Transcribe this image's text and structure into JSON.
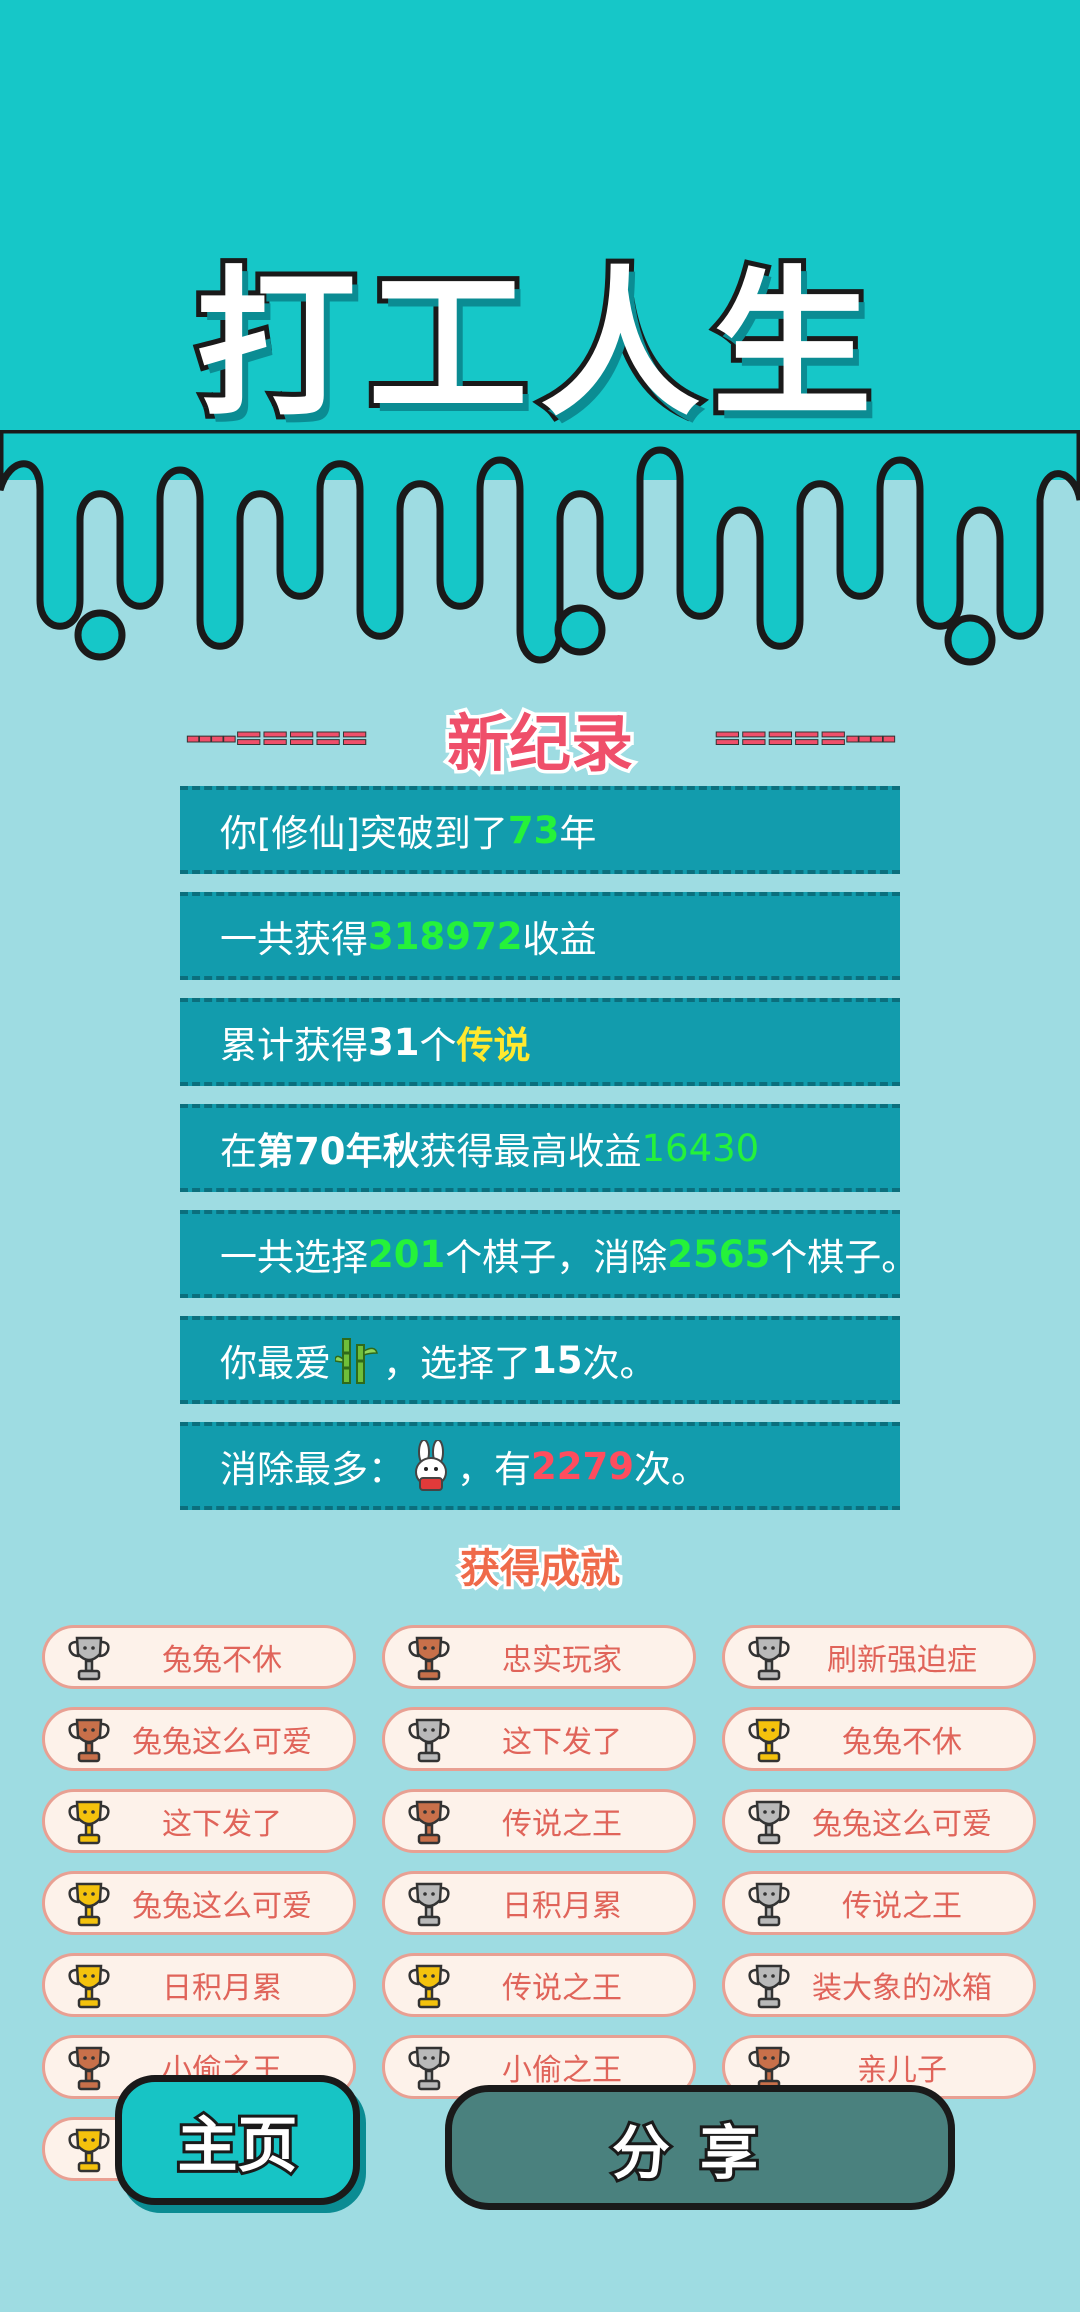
{
  "header": {
    "title": "打工人生"
  },
  "record": {
    "dash_left": "----=====",
    "heading": "新纪录",
    "dash_right": "=====----",
    "rows": [
      {
        "a": "你[修仙]突破到了",
        "b": "73",
        "c": "年"
      },
      {
        "a": "一共获得",
        "b": "318972",
        "c": "收益"
      },
      {
        "a": "累计获得",
        "b": "31",
        "c": "个",
        "d": "传说"
      },
      {
        "a": "在 ",
        "b": "第70年秋",
        "c": " 获得最高收益",
        "d": "16430"
      },
      {
        "a": "一共选择",
        "b": "201",
        "c": "个棋子，消除",
        "d": "2565",
        "e": "个棋子。"
      },
      {
        "a": "你最爱",
        "icon": "bamboo-icon",
        "c": "，选择了",
        "b": "15",
        "d": "次。"
      },
      {
        "a": "消除最多：",
        "icon": "rabbit-icon",
        "c": "，有",
        "b": "2279",
        "d": "次。"
      }
    ]
  },
  "achievements": {
    "title": "获得成就",
    "items": [
      {
        "label": "兔兔不休",
        "tier": "silver"
      },
      {
        "label": "忠实玩家",
        "tier": "bronze"
      },
      {
        "label": "刷新强迫症",
        "tier": "silver"
      },
      {
        "label": "兔兔这么可爱",
        "tier": "bronze"
      },
      {
        "label": "这下发了",
        "tier": "silver"
      },
      {
        "label": "兔兔不休",
        "tier": "gold"
      },
      {
        "label": "这下发了",
        "tier": "gold"
      },
      {
        "label": "传说之王",
        "tier": "bronze"
      },
      {
        "label": "兔兔这么可爱",
        "tier": "silver"
      },
      {
        "label": "兔兔这么可爱",
        "tier": "gold"
      },
      {
        "label": "日积月累",
        "tier": "silver"
      },
      {
        "label": "传说之王",
        "tier": "silver"
      },
      {
        "label": "日积月累",
        "tier": "gold"
      },
      {
        "label": "传说之王",
        "tier": "gold"
      },
      {
        "label": "装大象的冰箱",
        "tier": "silver"
      },
      {
        "label": "小偷之王",
        "tier": "bronze"
      },
      {
        "label": "小偷之王",
        "tier": "silver"
      },
      {
        "label": "亲儿子",
        "tier": "bronze"
      },
      {
        "label": "",
        "tier": "gold"
      }
    ]
  },
  "buttons": {
    "home": "主页",
    "share": "分享"
  },
  "colors": {
    "teal": "#16c7c8",
    "panel": "#129cad",
    "highlight_green": "#25f23a",
    "highlight_yellow": "#ffe92e",
    "highlight_red": "#ff4d5e",
    "gold": "#f4c20d",
    "silver": "#b9b9b9",
    "bronze": "#c8704a"
  }
}
